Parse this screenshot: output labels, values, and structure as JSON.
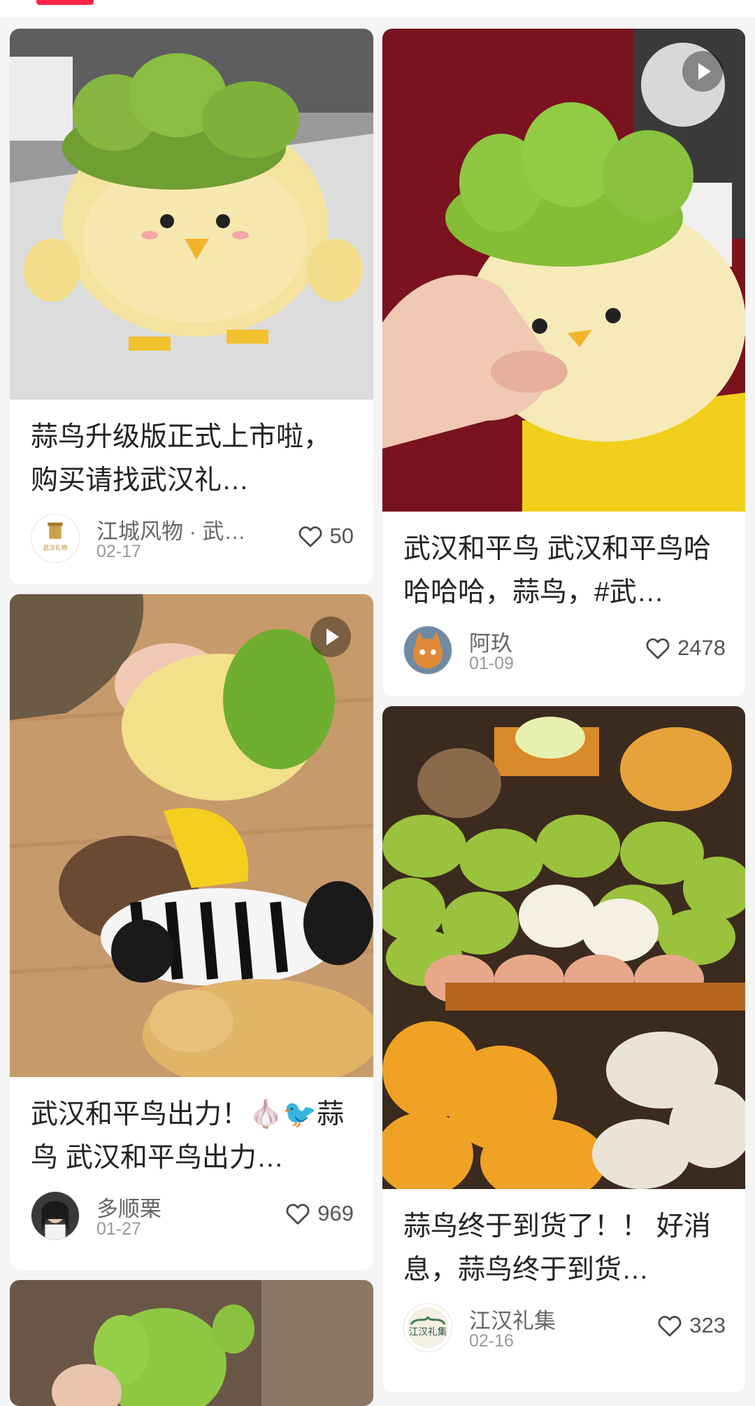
{
  "cards": [
    {
      "title": "蒜鸟升级版正式上市啦，购买请找武汉礼…",
      "author": "江城风物 · 武…",
      "date": "02-17",
      "likes": "50",
      "has_video": false,
      "avatar_text": "武汉礼物"
    },
    {
      "title": "武汉和平鸟 武汉和平鸟哈哈哈哈，蒜鸟，#武…",
      "author": "阿玖",
      "date": "01-09",
      "likes": "2478",
      "has_video": true
    },
    {
      "title": "武汉和平鸟出力！🧄🐦蒜鸟 武汉和平鸟出力…",
      "author": "多顺栗",
      "date": "01-27",
      "likes": "969",
      "has_video": true
    },
    {
      "title": "蒜鸟终于到货了！！ 好消息，蒜鸟终于到货…",
      "author": "江汉礼集",
      "date": "02-16",
      "likes": "323",
      "has_video": false,
      "avatar_text": "江汉礼集"
    }
  ],
  "icons": {
    "like": "heart-outline-icon",
    "video": "play-icon"
  },
  "colors": {
    "accent": "#ff2442",
    "background": "#f5f5f5",
    "card": "#ffffff"
  }
}
